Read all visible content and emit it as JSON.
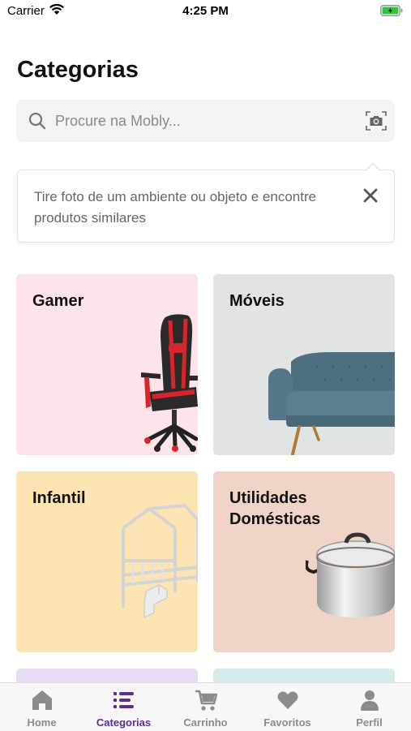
{
  "status_bar": {
    "carrier": "Carrier",
    "time": "4:25 PM"
  },
  "page": {
    "title": "Categorias"
  },
  "search": {
    "placeholder": "Procure na Mobly..."
  },
  "tooltip": {
    "text": "Tire foto de um ambiente ou objeto e encontre produtos similares"
  },
  "categories": [
    {
      "label": "Gamer",
      "color": "#fde4e8"
    },
    {
      "label": "Móveis",
      "color": "#e0e5e4"
    },
    {
      "label": "Infantil",
      "color": "#fde5b3"
    },
    {
      "label": "Utilidades Domésticas",
      "color": "#efd4c7"
    }
  ],
  "tabs": [
    {
      "label": "Home",
      "icon": "home-icon"
    },
    {
      "label": "Categorias",
      "icon": "categories-icon",
      "active": true
    },
    {
      "label": "Carrinho",
      "icon": "cart-icon"
    },
    {
      "label": "Favoritos",
      "icon": "heart-icon"
    },
    {
      "label": "Perfil",
      "icon": "user-icon"
    }
  ],
  "colors": {
    "accent": "#5a2d96",
    "inactive": "#8c8c8c",
    "battery": "#33c441"
  }
}
